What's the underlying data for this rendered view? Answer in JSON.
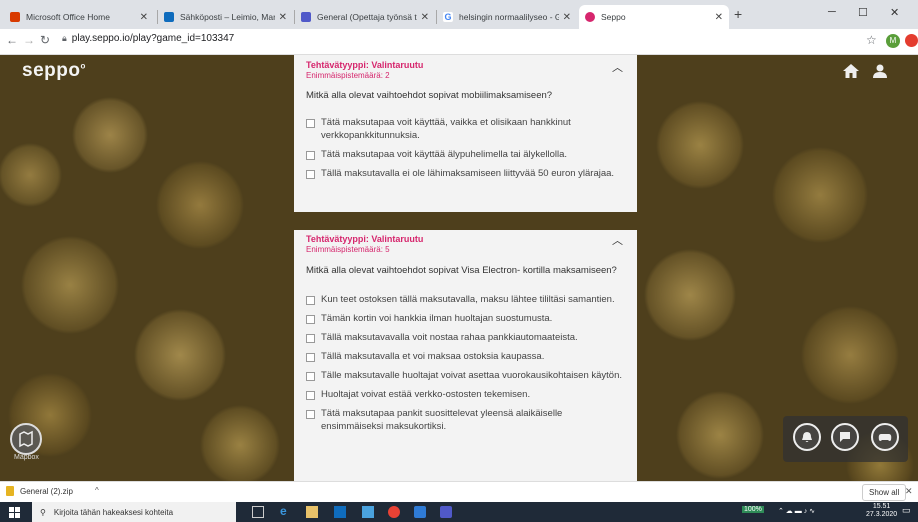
{
  "browser": {
    "tabs": [
      {
        "title": "Microsoft Office Home",
        "color": "#d83b01",
        "active": false
      },
      {
        "title": "Sähköposti – Leimio, Marjo P – C",
        "color": "#0f6cbd",
        "active": false
      },
      {
        "title": "General (Opettaja työnsä tutkija)",
        "color": "#5059c9",
        "active": false
      },
      {
        "title": "helsingin normaalilyseo - Google",
        "color": "#4285f4",
        "active": false
      },
      {
        "title": "Seppo",
        "color": "#d6266d",
        "active": true
      }
    ],
    "url": "play.seppo.io/play?game_id=103347",
    "profile_initial": "M"
  },
  "app": {
    "logo": "seppo",
    "mapbox_label": "Mapbox"
  },
  "tasks": [
    {
      "type": "Tehtävätyyppi: Valintaruutu",
      "max_points": "Enimmäispistemäärä: 2",
      "question": "Mitkä alla olevat vaihtoehdot sopivat mobiilimaksamiseen?",
      "options": [
        "Tätä maksutapaa voit käyttää, vaikka et olisikaan hankkinut verkkopankkitunnuksia.",
        "Tätä maksutapaa voit käyttää älypuhelimella tai älykellolla.",
        "Tällä maksutavalla ei ole lähimaksamiseen liittyvää 50 euron ylärajaa."
      ]
    },
    {
      "type": "Tehtävätyyppi: Valintaruutu",
      "max_points": "Enimmäispistemäärä: 5",
      "question": "Mitkä alla olevat vaihtoehdot sopivat Visa Electron- kortilla maksamiseen?",
      "options": [
        "Kun teet ostoksen tällä maksutavalla, maksu lähtee tililtäsi samantien.",
        "Tämän kortin voi hankkia ilman huoltajan suostumusta.",
        "Tällä maksutavavalla voit nostaa rahaa pankkiautomaateista.",
        "Tällä maksutavalla et voi maksaa ostoksia kaupassa.",
        "Tälle maksutavalle huoltajat voivat asettaa vuorokausikohtaisen käytön.",
        "Huoltajat voivat estää verkko-ostosten tekemisen.",
        "Tätä maksutapaa pankit suosittelevat yleensä alaikäiselle ensimmäiseksi maksukortiksi."
      ]
    }
  ],
  "downloads": {
    "file": "General (2).zip",
    "show_all": "Show all"
  },
  "taskbar": {
    "search_placeholder": "Kirjoita tähän hakeaksesi kohteita",
    "battery": "100%",
    "time": "15.51",
    "date": "27.3.2020"
  }
}
